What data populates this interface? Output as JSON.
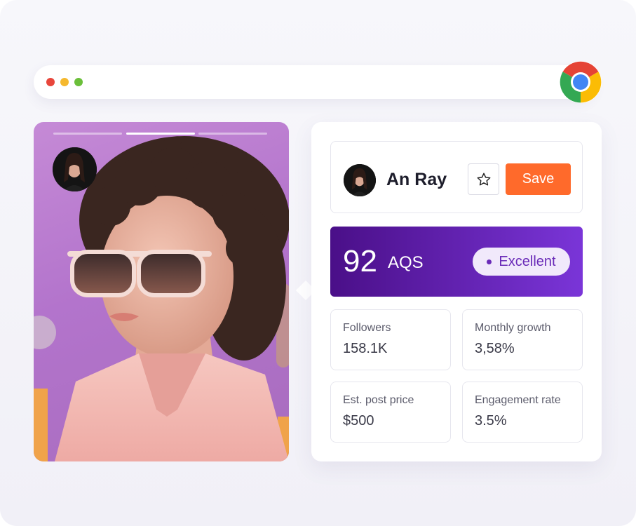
{
  "browser": {
    "window_controls": [
      "close",
      "minimize",
      "maximize"
    ],
    "colors": {
      "close": "#e8463b",
      "minimize": "#f5b82e",
      "maximize": "#6bbf3a"
    },
    "logo_icon": "chrome-icon"
  },
  "story": {
    "segments": 3,
    "active_segment": 2,
    "background_color": "#b779cc"
  },
  "profile": {
    "name": "An Ray",
    "star_icon": "star-outline-icon",
    "save_label": "Save",
    "save_color": "#ff6a2b"
  },
  "score": {
    "value": "92",
    "label": "AQS",
    "rating": "Excellent",
    "gradient_start": "#4a0f88",
    "gradient_end": "#7a35d8",
    "rating_color": "#6a2bb8"
  },
  "stats": [
    {
      "label": "Followers",
      "value": "158.1K"
    },
    {
      "label": "Monthly growth",
      "value": "3,58%"
    },
    {
      "label": "Est. post price",
      "value": "$500"
    },
    {
      "label": "Engagement rate",
      "value": "3.5%"
    }
  ]
}
